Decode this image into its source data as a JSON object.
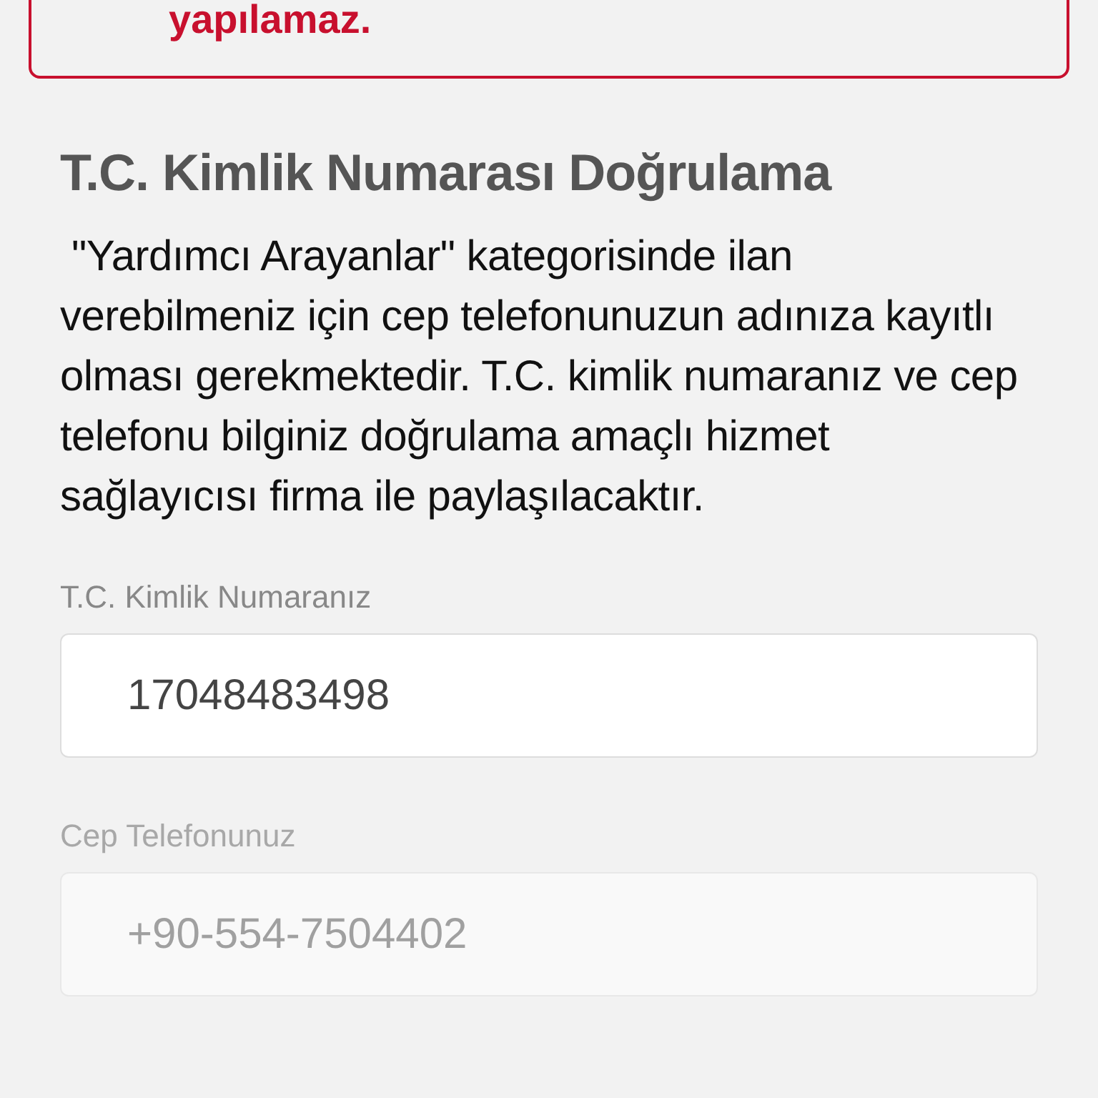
{
  "alert": {
    "text": "yapılamaz."
  },
  "section": {
    "title": "T.C. Kimlik Numarası Doğrulama",
    "description": " \"Yardımcı Arayanlar\" kategorisinde ilan verebilmeniz için cep telefonunuzun adınıza kayıtlı olması gerekmektedir. T.C. kimlik numaranız ve cep telefonu bilginiz doğrulama amaçlı hizmet sağlayıcısı firma ile paylaşılacaktır."
  },
  "fields": [
    {
      "label": "T.C. Kimlik Numaranız",
      "value": "17048483498",
      "disabled": false
    },
    {
      "label": "Cep Telefonunuz",
      "value": "+90-554-7504402",
      "disabled": true
    }
  ]
}
